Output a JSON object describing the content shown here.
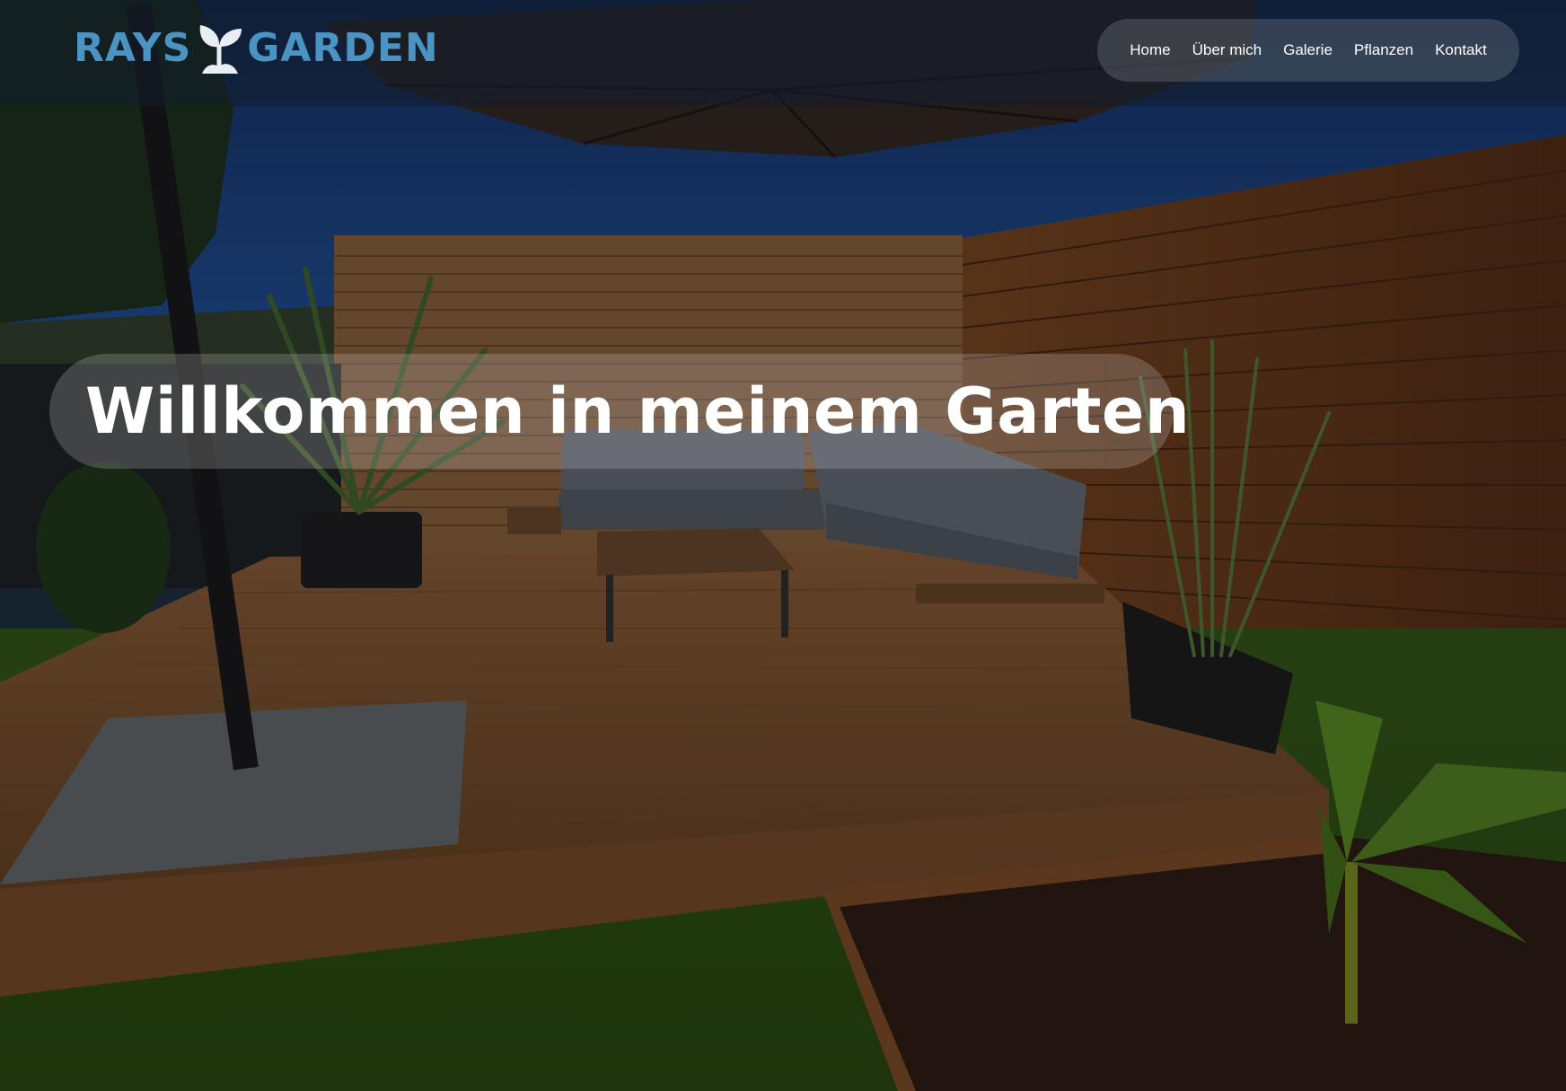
{
  "brand": {
    "logo_left": "RAYS",
    "logo_right": "GARDEN",
    "logo_color": "#4b93c2"
  },
  "nav": {
    "items": [
      {
        "label": "Home"
      },
      {
        "label": "Über mich"
      },
      {
        "label": "Galerie"
      },
      {
        "label": "Pflanzen"
      },
      {
        "label": "Kontakt"
      }
    ]
  },
  "hero": {
    "title": "Willkommen in meinem Garten",
    "image_icon": "garden-patio-photo"
  }
}
